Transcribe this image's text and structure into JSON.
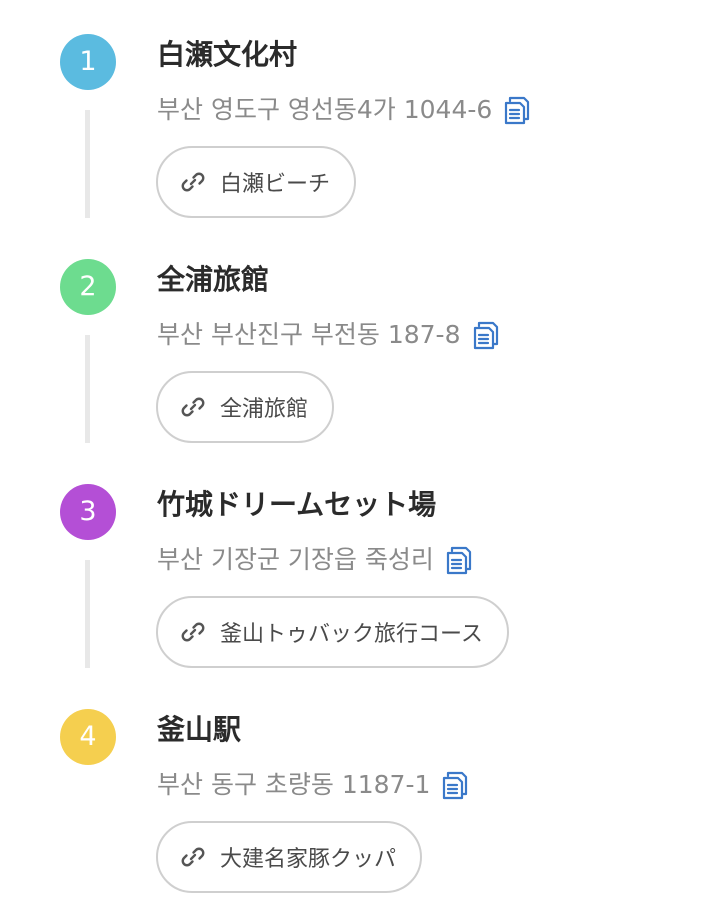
{
  "stops": [
    {
      "number": "1",
      "color": "#5bbbe0",
      "title": "白瀬文化村",
      "address": "부산 영도구 영선동4가 1044-6",
      "link_label": "白瀬ビーチ",
      "copy_icon": "copy-icon",
      "link_icon": "link-icon"
    },
    {
      "number": "2",
      "color": "#6ddc8f",
      "title": "全浦旅館",
      "address": "부산 부산진구 부전동 187-8",
      "link_label": "全浦旅館",
      "copy_icon": "copy-icon",
      "link_icon": "link-icon"
    },
    {
      "number": "3",
      "color": "#b44fd6",
      "title": "竹城ドリームセット場",
      "address": "부산 기장군 기장읍 죽성리",
      "link_label": "釜山トゥバック旅行コース",
      "copy_icon": "copy-icon",
      "link_icon": "link-icon"
    },
    {
      "number": "4",
      "color": "#f5cf4f",
      "title": "釜山駅",
      "address": "부산 동구 초량동 1187-1",
      "link_label": "大建名家豚クッパ",
      "copy_icon": "copy-icon",
      "link_icon": "link-icon"
    }
  ],
  "colors": {
    "copy_icon": "#3a78c9",
    "link_icon": "#555555",
    "connector": "#e8e8e8"
  }
}
